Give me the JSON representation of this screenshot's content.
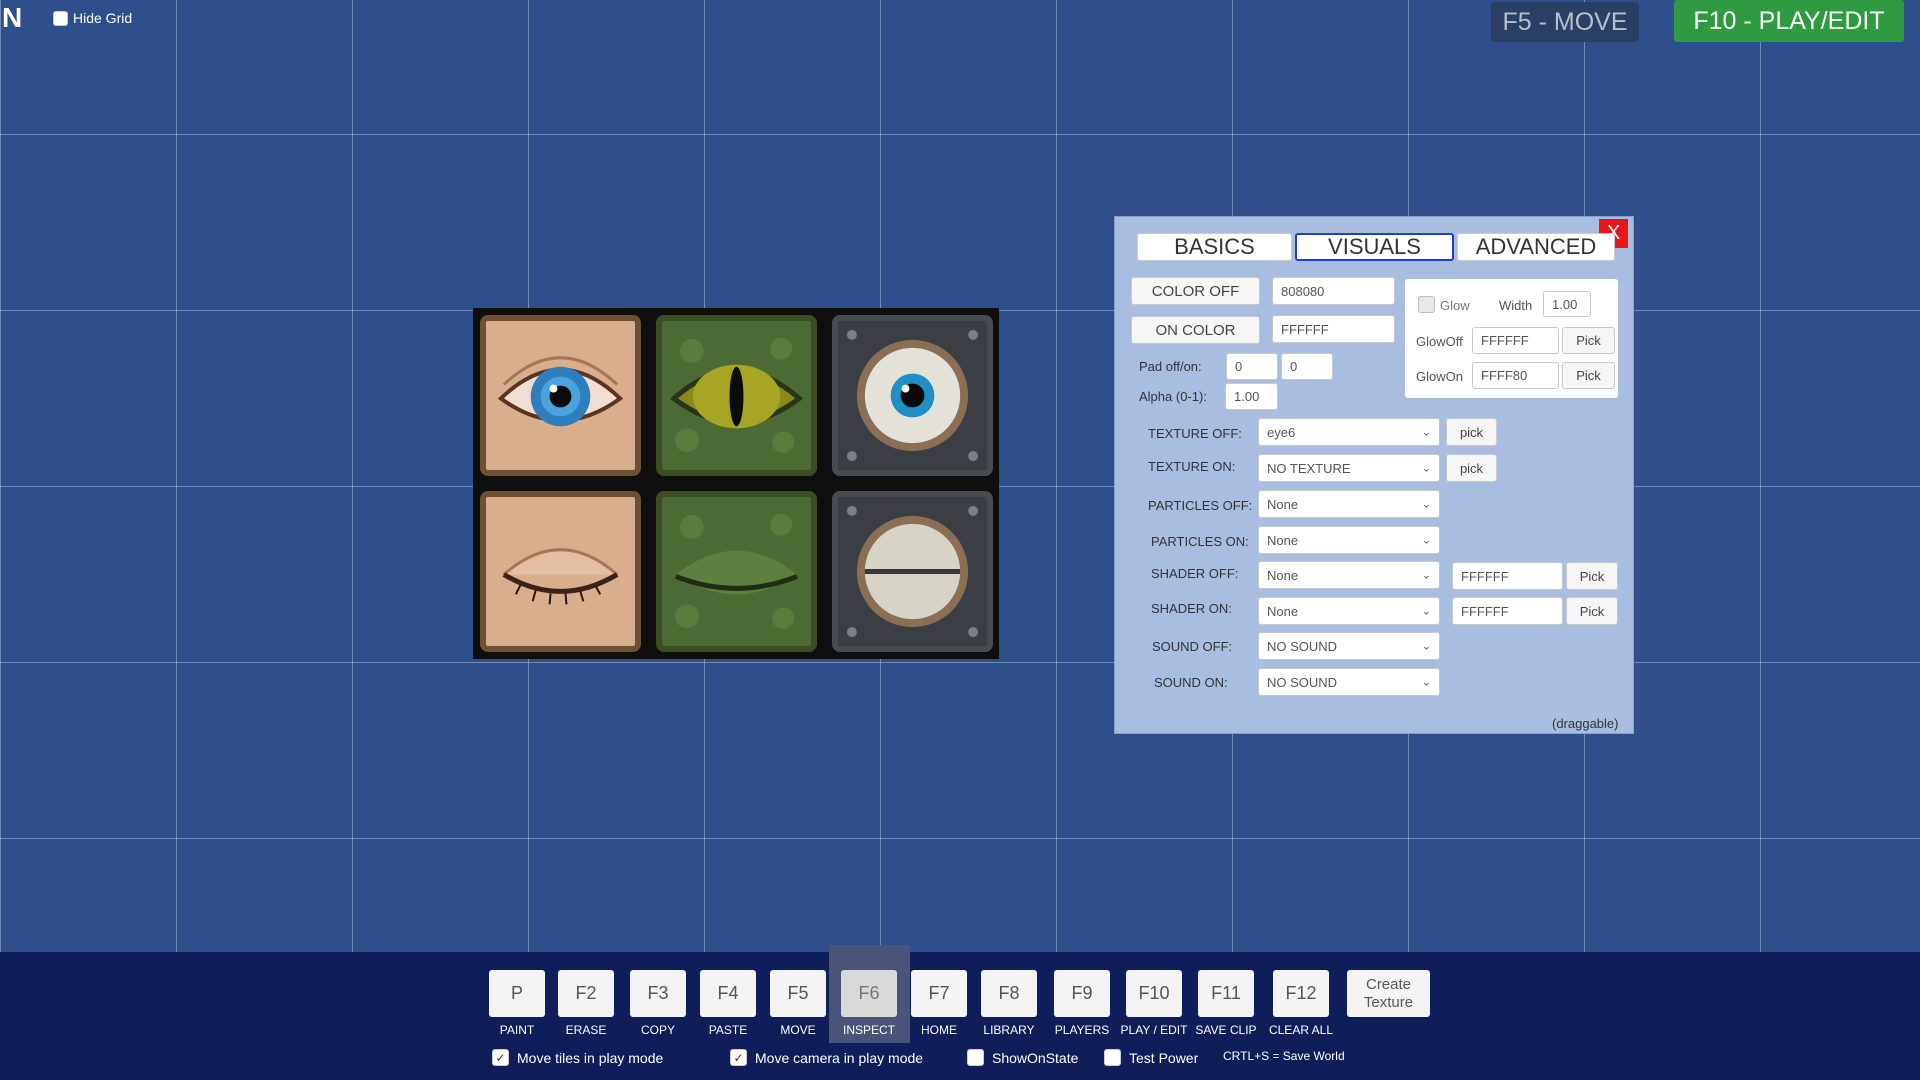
{
  "top": {
    "logo": "N",
    "hide_grid": "Hide Grid",
    "move_btn": "F5 - MOVE",
    "play_btn": "F10 - PLAY/EDIT"
  },
  "panel": {
    "close": "X",
    "tabs": [
      "BASICS",
      "VISUALS",
      "ADVANCED"
    ],
    "active_tab": "VISUALS",
    "color_off_btn": "COLOR OFF",
    "color_off_value": "808080",
    "on_color_btn": "ON COLOR",
    "on_color_value": "FFFFFF",
    "pad_label": "Pad off/on:",
    "pad_off": "0",
    "pad_on": "0",
    "alpha_label": "Alpha (0-1):",
    "alpha_value": "1.00",
    "glow_label": "Glow",
    "width_label": "Width",
    "width_value": "1.00",
    "glow_off_label": "GlowOff",
    "glow_off_value": "FFFFFF",
    "glow_on_label": "GlowOn",
    "glow_on_value": "FFFF80",
    "pick": "Pick",
    "pick_lower": "pick",
    "texture_off_label": "TEXTURE OFF:",
    "texture_off_value": "eye6",
    "texture_on_label": "TEXTURE ON:",
    "texture_on_value": "NO TEXTURE",
    "particles_off_label": "PARTICLES OFF:",
    "particles_off_value": "None",
    "particles_on_label": "PARTICLES ON:",
    "particles_on_value": "None",
    "shader_off_label": "SHADER OFF:",
    "shader_off_value": "None",
    "shader_off_color": "FFFFFF",
    "shader_on_label": "SHADER ON:",
    "shader_on_value": "None",
    "shader_on_color": "FFFFFF",
    "sound_off_label": "SOUND OFF:",
    "sound_off_value": "NO SOUND",
    "sound_on_label": "SOUND ON:",
    "sound_on_value": "NO SOUND",
    "draggable": "(draggable)"
  },
  "toolbar": {
    "buttons": [
      {
        "key": "P",
        "label": "PAINT"
      },
      {
        "key": "F2",
        "label": "ERASE"
      },
      {
        "key": "F3",
        "label": "COPY"
      },
      {
        "key": "F4",
        "label": "PASTE"
      },
      {
        "key": "F5",
        "label": "MOVE"
      },
      {
        "key": "F6",
        "label": "INSPECT"
      },
      {
        "key": "F7",
        "label": "HOME"
      },
      {
        "key": "F8",
        "label": "LIBRARY"
      },
      {
        "key": "F9",
        "label": "PLAYERS"
      },
      {
        "key": "F10",
        "label": "PLAY / EDIT"
      },
      {
        "key": "F11",
        "label": "SAVE CLIP"
      },
      {
        "key": "F12",
        "label": "CLEAR ALL"
      }
    ],
    "create_texture": "Create Texture",
    "options": {
      "move_tiles": "Move tiles in play mode",
      "move_camera": "Move camera in play mode",
      "show_on_state": "ShowOnState",
      "test_power": "Test Power",
      "save_hint": "CRTL+S = Save World"
    }
  },
  "colors": {
    "grid_bg": "#2f4f8c",
    "toolbar_bg": "#0f1e5a",
    "panel_bg": "#a9bde1",
    "play_green": "#2f9a3f",
    "close_red": "#e8161b",
    "active_tab_border": "#1e40c8"
  }
}
